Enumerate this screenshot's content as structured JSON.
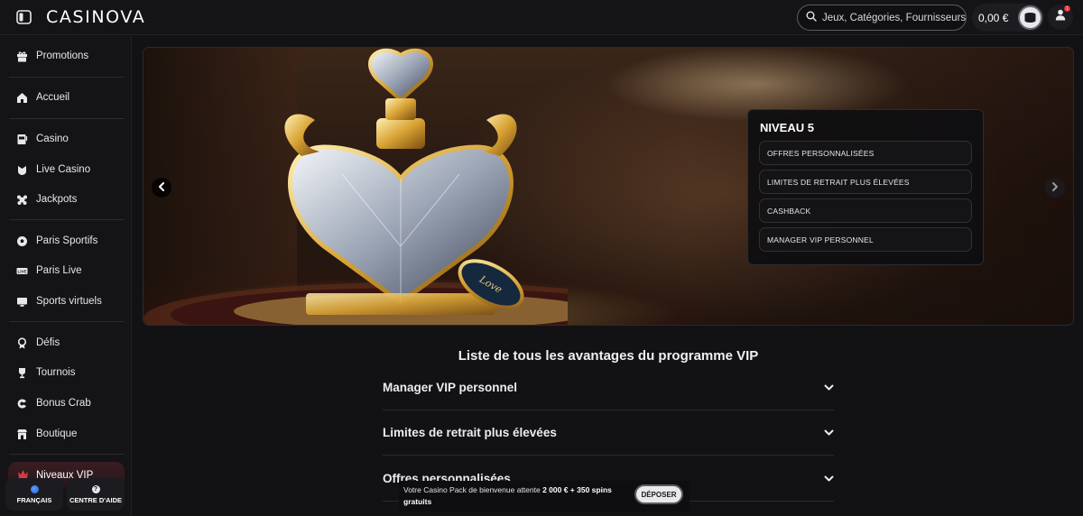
{
  "header": {
    "logo": "CASINOVA",
    "search_placeholder": "Jeux, Catégories, Fournisseurs",
    "balance": "0,00 €",
    "notification_count": "1"
  },
  "sidebar": {
    "items": [
      {
        "label": "Promotions",
        "icon": "gift-icon"
      },
      {
        "label": "Accueil",
        "icon": "home-icon"
      },
      {
        "label": "Casino",
        "icon": "slot-machine-icon"
      },
      {
        "label": "Live Casino",
        "icon": "live-casino-icon"
      },
      {
        "label": "Jackpots",
        "icon": "jackpot-icon"
      },
      {
        "label": "Paris Sportifs",
        "icon": "soccer-ball-icon"
      },
      {
        "label": "Paris Live",
        "icon": "live-betting-icon"
      },
      {
        "label": "Sports virtuels",
        "icon": "virtual-sports-icon"
      },
      {
        "label": "Défis",
        "icon": "medal-icon"
      },
      {
        "label": "Tournois",
        "icon": "trophy-icon"
      },
      {
        "label": "Bonus Crab",
        "icon": "crab-icon"
      },
      {
        "label": "Boutique",
        "icon": "shop-icon"
      }
    ],
    "vip_label": "Niveaux VIP",
    "language_label": "FRANÇAIS",
    "help_label": "CENTRE D'AIDE"
  },
  "banner": {
    "level_title": "NIVEAU 5",
    "perks": [
      "OFFRES PERSONNALISÉES",
      "LIMITES DE RETRAIT PLUS ÉLEVÉES",
      "CASHBACK",
      "MANAGER VIP PERSONNEL"
    ]
  },
  "benefits": {
    "title": "Liste de tous les avantages du programme VIP",
    "items": [
      "Manager VIP personnel",
      "Limites de retrait plus élevées",
      "Offres personnalisées"
    ]
  },
  "promo": {
    "text_prefix": "Votre Casino Pack de bienvenue attente",
    "amount": "2 000 € + 350 spins",
    "text_suffix": "gratuits",
    "deposit_label": "DÉPOSER"
  },
  "colors": {
    "background": "#121215",
    "sidebar": "#141417",
    "vip_accent": "#c0303a",
    "notification": "#e0343a"
  }
}
